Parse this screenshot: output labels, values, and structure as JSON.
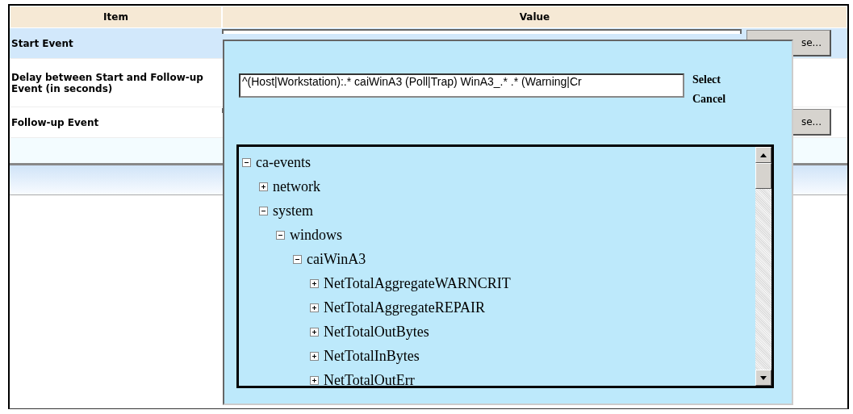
{
  "table": {
    "columns": [
      "Item",
      "Value"
    ],
    "rows": [
      {
        "item": "Start Event",
        "selected": true,
        "browse": "se..."
      },
      {
        "item": "Delay between Start and Follow-up Event (in seconds)",
        "selected": false
      },
      {
        "item": "Follow-up Event",
        "selected": false,
        "browse": "se..."
      }
    ]
  },
  "dialog": {
    "pattern": "^(Host|Workstation):.* caiWinA3 (Poll|Trap) WinA3_.* .* (Warning|Cr",
    "actions": [
      "Select",
      "Cancel"
    ],
    "tree": [
      {
        "label": "ca-events",
        "expanded": true,
        "children": [
          {
            "label": "network",
            "expanded": false
          },
          {
            "label": "system",
            "expanded": true,
            "children": [
              {
                "label": "windows",
                "expanded": true,
                "children": [
                  {
                    "label": "caiWinA3",
                    "expanded": true,
                    "children": [
                      {
                        "label": "NetTotalAggregateWARNCRIT",
                        "expanded": false
                      },
                      {
                        "label": "NetTotalAggregateREPAIR",
                        "expanded": false
                      },
                      {
                        "label": "NetTotalOutBytes",
                        "expanded": false
                      },
                      {
                        "label": "NetTotalInBytes",
                        "expanded": false
                      },
                      {
                        "label": "NetTotalOutErr",
                        "expanded": false
                      }
                    ]
                  }
                ]
              }
            ]
          }
        ]
      }
    ]
  }
}
